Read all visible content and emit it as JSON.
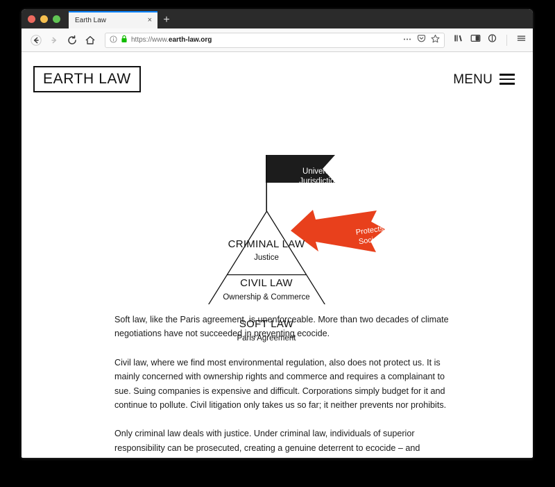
{
  "browser": {
    "traffic_lights": [
      "close",
      "minimize",
      "maximize"
    ],
    "tab": {
      "title": "Earth Law",
      "close_label": "×"
    },
    "new_tab_label": "+",
    "nav": {
      "back_label": "Back",
      "forward_label": "Forward",
      "reload_label": "Reload",
      "home_label": "Home"
    },
    "url_bar": {
      "scheme": "https://www.",
      "domain": "earth-law.org",
      "full_url": "https://www.earth-law.org",
      "security_icon": "lock-icon",
      "info_icon": "page-info-icon",
      "page_actions_icon": "ellipsis-icon",
      "reader_icon": "pocket-icon",
      "bookmark_icon": "star-icon"
    },
    "toolbar_icons": [
      "library-icon",
      "sidebar-icon",
      "account-icon",
      "app-menu-icon"
    ]
  },
  "site": {
    "logo": "EARTH LAW",
    "menu_label": "MENU",
    "menu_icon": "hamburger-icon"
  },
  "diagram": {
    "banner": {
      "line1": "Universal",
      "line2": "Jurisdiction",
      "fill": "#1c1c1c",
      "text_color": "#ffffff"
    },
    "arrow": {
      "line1": "Protects",
      "line2": "Society",
      "fill": "#e8401c",
      "text_color": "#ffffff"
    },
    "tiers": [
      {
        "title": "CRIMINAL LAW",
        "subtitle": "Justice"
      },
      {
        "title": "CIVIL LAW",
        "subtitle": "Ownership & Commerce"
      },
      {
        "title": "SOFT LAW",
        "subtitle": "Paris Agreement"
      }
    ],
    "stroke": "#111111"
  },
  "article": {
    "paragraphs": [
      "Soft law, like the Paris agreement, is unenforceable. More than two decades of climate negotiations have not succeeded in preventing ecocide.",
      "Civil law, where we find most environmental regulation, also does not protect us. It is mainly concerned with ownership rights and commerce and requires a complainant to sue. Suing companies is expensive and difficult. Corporations simply budget for it and continue to pollute. Civil litigation only takes us so far; it neither prevents nor prohibits.",
      "Only criminal law deals with justice. Under criminal law, individuals of superior responsibility can be prosecuted, creating a genuine deterrent to ecocide – and genuine protection for the Earth and communities."
    ]
  }
}
